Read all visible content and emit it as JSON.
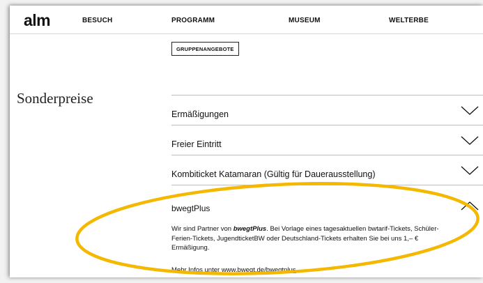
{
  "header": {
    "logo": "alm",
    "nav": [
      "BESUCH",
      "PROGRAMM",
      "MUSEUM",
      "WELTERBE"
    ]
  },
  "gruppen_button": "GRUPPENANGEBOTE",
  "section_title": "Sonderpreise",
  "accordion": {
    "collapsed_items": [
      "Ermäßigungen",
      "Freier Eintritt",
      "Kombiticket Katamaran (Gültig für Dauerausstellung)"
    ],
    "open_item": {
      "title": "bwegtPlus",
      "body_prefix": "Wir sind Partner von ",
      "body_bold": "bwegtPlus",
      "body_suffix": ". Bei Vorlage eines tagesaktuellen bwtarif-Tickets, Schüler-Ferien-Tickets, JugendticketBW oder Deutschland-Tickets erhalten Sie bei uns 1,– € Ermäßigung.",
      "more_label": "Mehr Infos unter",
      "more_link": "www.bwegt.de/bwegtplus"
    }
  },
  "colors": {
    "highlight_ellipse": "#f5b800",
    "divider": "#bdbdbd",
    "text": "#111111"
  },
  "icons": {
    "collapsed": "chevron-down-icon",
    "expanded": "chevron-up-icon"
  }
}
